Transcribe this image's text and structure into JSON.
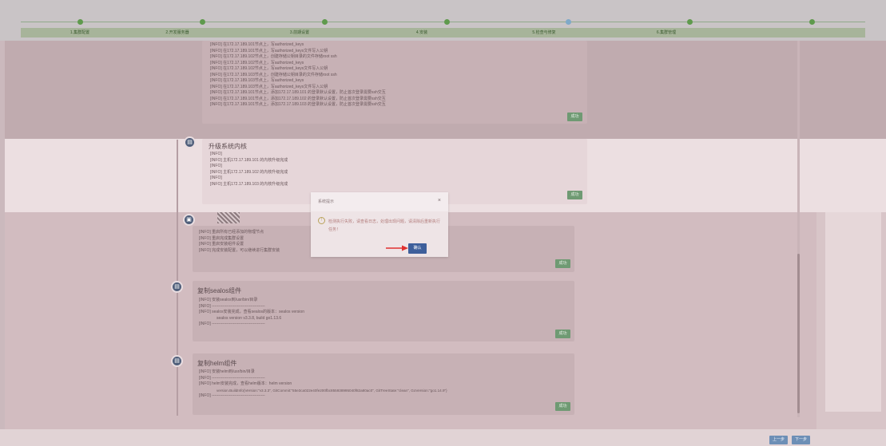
{
  "stepper": {
    "steps": [
      {
        "label": "1.集群配置"
      },
      {
        "label": "2.开发服务器"
      },
      {
        "label": "3.前期设置"
      },
      {
        "label": "4.安装"
      },
      {
        "label": "5.检查与修复"
      },
      {
        "label": "6.集群管理"
      }
    ]
  },
  "cards": [
    {
      "log": [
        "[INFO] 在172.17.189.101节点上，写authorized_keys",
        "[INFO] 在172.17.189.101节点上，写authorized_keys文件写入公钥",
        "[INFO] 在172.17.189.102节点上，创建存储公钥目录的文件存储root ssh",
        "[INFO] 在172.17.189.102节点上，写authorized_keys",
        "[INFO] 在172.17.189.102节点上，写authorized_keys文件写入公钥",
        "[INFO] 在172.17.189.103节点上，创建存储公钥目录的文件存储root ssh",
        "[INFO] 在172.17.189.103节点上，写authorized_keys",
        "[INFO] 在172.17.189.103节点上，写authorized_keys文件写入公钥",
        "[INFO] 在172.17.189.101节点上，添加172.17.189.101 的登录默认设置，防止首次登录需要ssh交互",
        "[INFO] 在172.17.189.101节点上，添加172.17.189.102 的登录默认设置，防止首次登录需要ssh交互",
        "[INFO] 在172.17.189.101节点上，添加172.17.189.103 的登录默认设置，防止首次登录需要ssh交互"
      ],
      "status": "成功"
    },
    {
      "title": "升级系统内核",
      "log": [
        "[INFO]",
        "[INFO] 主机172.17.189.101 的内核升级完成",
        "[INFO]",
        "[INFO] 主机172.17.189.102 的内核升级完成",
        "[INFO]",
        "[INFO] 主机172.17.189.103 的内核升级完成"
      ],
      "status": "成功"
    },
    {
      "log": [
        "[INFO] 重启所有已经添加的物理节点",
        "[INFO] 重启完成集群设置",
        "[INFO] 重启安装组件设置",
        "[INFO] 完成安装配置，可以继续进行集群安装"
      ],
      "status": "成功"
    },
    {
      "title": "复制sealos组件",
      "log": [
        "[INFO] 安装sealos到/usr/bin/目录",
        "[INFO] ----------------------------------------",
        "[INFO] sealos安装完成，查看sealos的版本：sealos version",
        "sealos version v3.3.8, build go1.13.6",
        "[INFO] ----------------------------------------"
      ],
      "status": "成功"
    },
    {
      "title": "复制helm组件",
      "log": [
        "[INFO] 安装helm到/usr/bin/目录",
        "[INFO] ----------------------------------------",
        "[INFO] helm安装完成，查看helm版本：helm version",
        "version.BuildInfo{Version:\"v3.3.3\", GitCommit:\"55e3ca022e40fe200fbc855938995040f82a80ac0\", GitTreeState:\"clean\", GoVersion:\"go1.14.9\"}",
        "[INFO] ----------------------------------------"
      ],
      "status": "成功"
    }
  ],
  "dialog": {
    "title": "系统提示",
    "close": "×",
    "message": "检测执行失败，请查看日志，处理出现问题，请清除后重新执行任务！",
    "confirm": "确认"
  },
  "footer": {
    "prev": "上一步",
    "next": "下一步"
  },
  "colors": {
    "success": "#6f9a73",
    "primary": "#3e5f9b",
    "step_done": "#5f9a4d",
    "step_current": "#7fa9c8"
  }
}
